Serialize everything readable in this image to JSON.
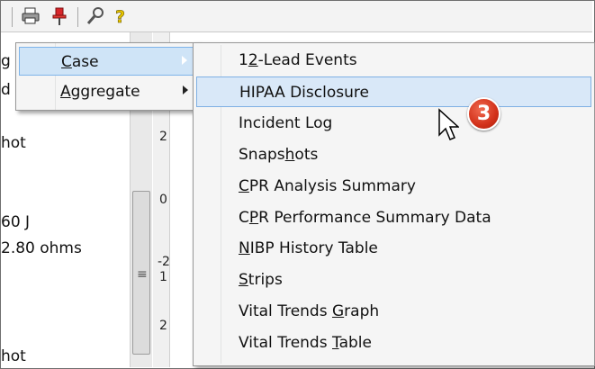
{
  "left_pane": {
    "lines": [
      "g",
      "d",
      "hot",
      "60 J",
      "2.80 ohms",
      "hot"
    ]
  },
  "right_pane": {
    "axis_labels": [
      "2",
      "0",
      "-2",
      "1",
      "2"
    ]
  },
  "toolbar": {
    "icons": [
      "print-icon",
      "pushpin-icon",
      "tools-icon",
      "help-icon"
    ]
  },
  "menu": {
    "items": [
      {
        "label": "Case",
        "mnemonic": "C",
        "has_submenu": true,
        "highlighted": true
      },
      {
        "label": "Aggregate",
        "mnemonic": "A",
        "has_submenu": true,
        "highlighted": false
      }
    ]
  },
  "submenu": {
    "items": [
      {
        "label": "12-Lead Events",
        "highlighted": false
      },
      {
        "label": "HIPAA Disclosure",
        "highlighted": true
      },
      {
        "label": "Incident Log",
        "highlighted": false
      },
      {
        "label": "Snapshots",
        "highlighted": false
      },
      {
        "label": "CPR Analysis Summary",
        "highlighted": false
      },
      {
        "label": "CPR Performance Summary Data",
        "highlighted": false
      },
      {
        "label": "NIBP History Table",
        "highlighted": false
      },
      {
        "label": "Strips",
        "highlighted": false
      },
      {
        "label": "Vital Trends Graph",
        "highlighted": false
      },
      {
        "label": "Vital Trends Table",
        "highlighted": false
      }
    ]
  },
  "callout": {
    "number": "3",
    "color": "#d2311a"
  }
}
